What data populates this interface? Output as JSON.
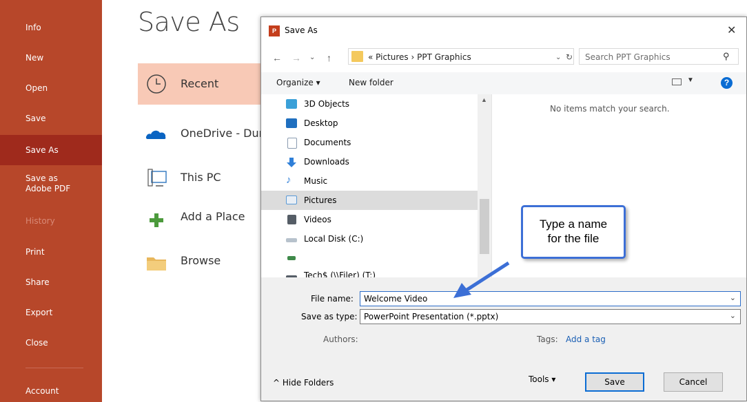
{
  "backstage": {
    "nav": [
      {
        "label": "Info"
      },
      {
        "label": "New"
      },
      {
        "label": "Open"
      },
      {
        "label": "Save"
      },
      {
        "label": "Save As"
      },
      {
        "label": "Save as Adobe PDF"
      },
      {
        "label": "History"
      },
      {
        "label": "Print"
      },
      {
        "label": "Share"
      },
      {
        "label": "Export"
      },
      {
        "label": "Close"
      },
      {
        "label": "Account"
      }
    ],
    "title": "Save As",
    "places": [
      {
        "label": "Recent",
        "icon": "clock-icon"
      },
      {
        "label": "OneDrive - Dur",
        "icon": "cloud-icon"
      },
      {
        "label": "This PC",
        "icon": "computer-icon"
      },
      {
        "label": "Add a Place",
        "icon": "plus-icon"
      },
      {
        "label": "Browse",
        "icon": "folder-icon"
      }
    ]
  },
  "dialog": {
    "title": "Save As",
    "close": "✕",
    "address": "« Pictures › PPT Graphics",
    "search_placeholder": "Search PPT Graphics",
    "toolbar": {
      "organize": "Organize ▾",
      "new_folder": "New folder"
    },
    "tree": [
      {
        "label": "3D Objects",
        "color": "#3aa0d8"
      },
      {
        "label": "Desktop",
        "color": "#1f6fbf"
      },
      {
        "label": "Documents",
        "color": "#8a9bb0"
      },
      {
        "label": "Downloads",
        "color": "#2f7fd8"
      },
      {
        "label": "Music",
        "color": "#2f7fd8"
      },
      {
        "label": "Pictures",
        "color": "#5a9ad6"
      },
      {
        "label": "Videos",
        "color": "#555d66"
      },
      {
        "label": "Local Disk (C:)",
        "color": "#6b7b8a"
      },
      {
        "label": "",
        "color": "#3f8a4a"
      },
      {
        "label": "Tech$ (\\\\Filer) (T:)",
        "color": "#555d66"
      }
    ],
    "empty_message": "No items match your search.",
    "file_name_label": "File name:",
    "file_name_value": "Welcome Video",
    "save_type_label": "Save as type:",
    "save_type_value": "PowerPoint Presentation (*.pptx)",
    "authors_label": "Authors:",
    "tags_label": "Tags:",
    "tags_link": "Add a tag",
    "hide_folders": "^ Hide Folders",
    "tools": "Tools ▾",
    "save_button": "Save",
    "cancel_button": "Cancel"
  },
  "callout": {
    "line1": "Type a name",
    "line2": "for the file"
  },
  "colors": {
    "sidebar": "#b7472a",
    "sidebar_active": "#9f2a1c",
    "recent_highlight": "#f8c9b6",
    "callout_border": "#3c6fd6"
  }
}
